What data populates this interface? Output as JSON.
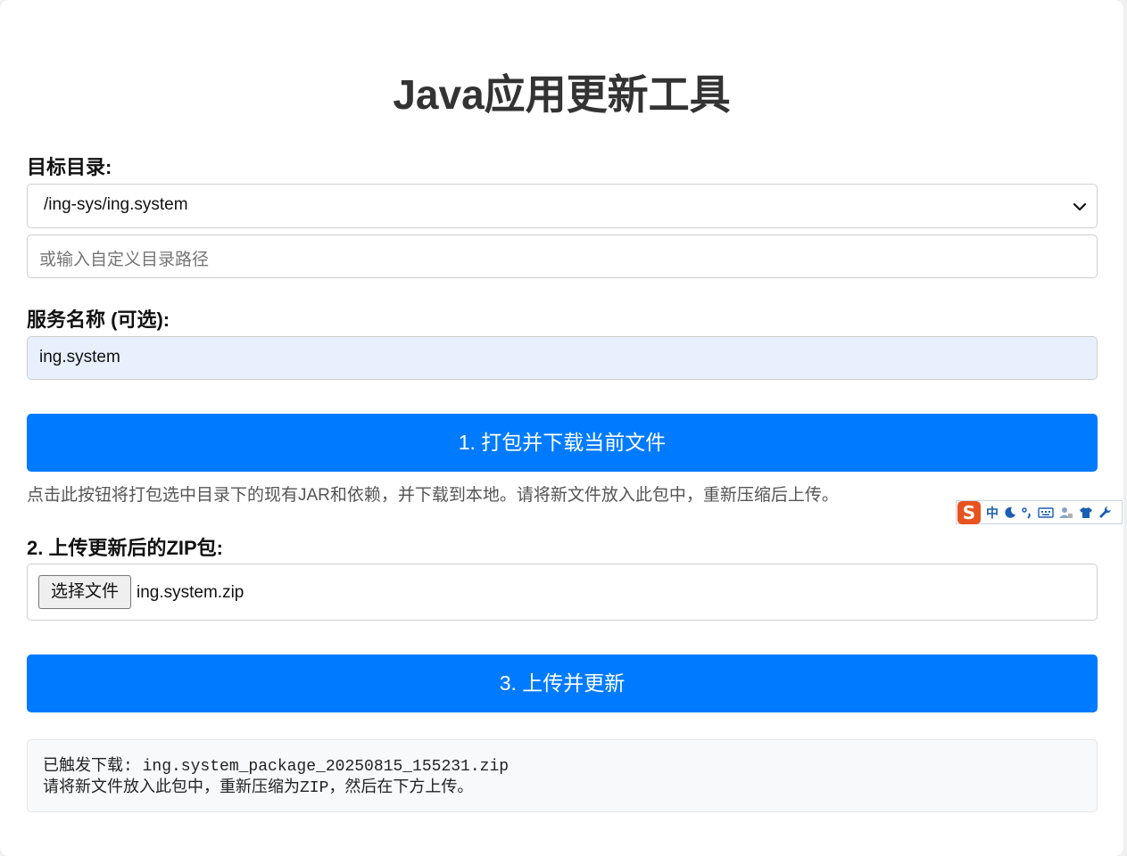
{
  "header": {
    "title": "Java应用更新工具"
  },
  "target_dir": {
    "label": "目标目录:",
    "selected": "/ing-sys/ing.system",
    "custom_placeholder": "或输入自定义目录路径"
  },
  "service": {
    "label": "服务名称 (可选):",
    "value": "ing.system"
  },
  "package_button": {
    "label": "1. 打包并下载当前文件",
    "hint": "点击此按钮将打包选中目录下的现有JAR和依赖，并下载到本地。请将新文件放入此包中，重新压缩后上传。"
  },
  "upload": {
    "label": "2. 上传更新后的ZIP包:",
    "choose_label": "选择文件",
    "filename": "ing.system.zip"
  },
  "update_button": {
    "label": "3. 上传并更新"
  },
  "log": {
    "line1": "已触发下载: ing.system_package_20250815_155231.zip",
    "line2": "请将新文件放入此包中，重新压缩为ZIP，然后在下方上传。"
  },
  "ime_toolbar": {
    "logo": "S",
    "mode": "中",
    "icons": [
      "moon-icon",
      "punctuation-icon",
      "keyboard-icon",
      "user-icon",
      "skin-shirt-icon",
      "settings-wrench-icon"
    ]
  },
  "colors": {
    "primary": "#007bff",
    "ime_logo": "#e8531f",
    "autofill_bg": "#e8f0fe"
  }
}
